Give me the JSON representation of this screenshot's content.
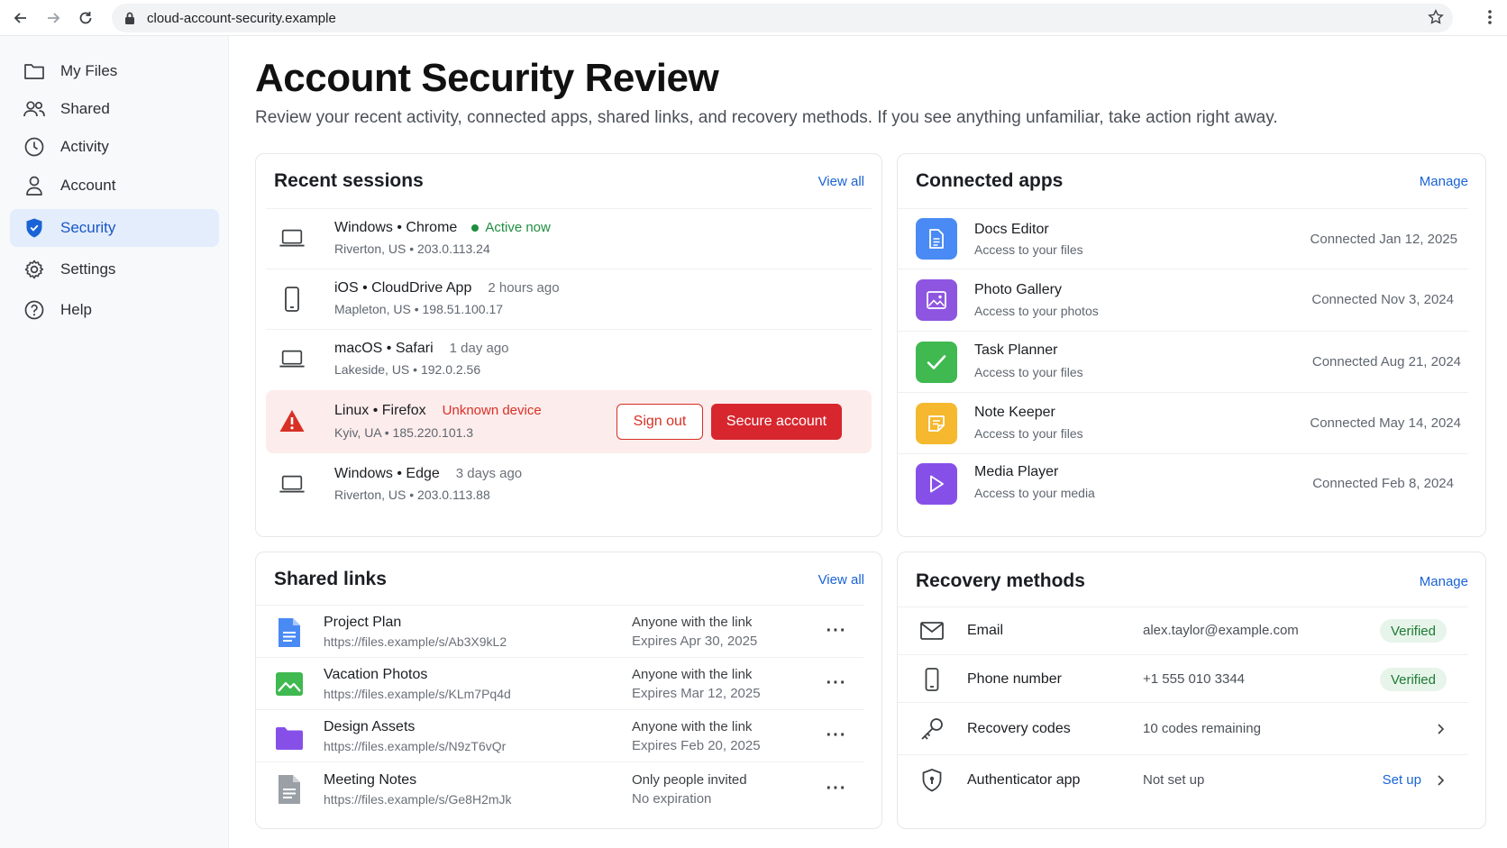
{
  "browser": {
    "url": "cloud-account-security.example"
  },
  "sidebar": {
    "items": [
      {
        "label": "My Files"
      },
      {
        "label": "Shared"
      },
      {
        "label": "Activity"
      },
      {
        "label": "Account"
      },
      {
        "label": "Security"
      },
      {
        "label": "Settings"
      },
      {
        "label": "Help"
      }
    ]
  },
  "page": {
    "title": "Account Security Review",
    "subtitle": "Review your recent activity, connected apps, shared links, and recovery methods. If you see anything unfamiliar, take action right away."
  },
  "sessions": {
    "title": "Recent sessions",
    "view_all": "View all",
    "rows": [
      {
        "device": "Windows • Chrome",
        "status": "Active now",
        "location": "Riverton, US  •  203.0.113.24"
      },
      {
        "device": "iOS • CloudDrive App",
        "status": "2 hours ago",
        "location": "Mapleton, US  •  198.51.100.17"
      },
      {
        "device": "macOS • Safari",
        "status": "1 day ago",
        "location": "Lakeside, US  •  192.0.2.56"
      },
      {
        "device": "Linux • Firefox",
        "status": "Unknown device",
        "location": "Kyiv, UA  •  185.220.101.3"
      },
      {
        "device": "Windows • Edge",
        "status": "3 days ago",
        "location": "Riverton, US  •  203.0.113.88"
      }
    ],
    "sign_out": "Sign out",
    "secure": "Secure account"
  },
  "apps": {
    "title": "Connected apps",
    "manage": "Manage",
    "rows": [
      {
        "name": "Docs Editor",
        "desc": "Access to your files",
        "date": "Connected Jan 12, 2025",
        "color": "#4a8af4"
      },
      {
        "name": "Photo Gallery",
        "desc": "Access to your photos",
        "date": "Connected Nov 3, 2024",
        "color": "#8e55e0"
      },
      {
        "name": "Task Planner",
        "desc": "Access to your files",
        "date": "Connected Aug 21, 2024",
        "color": "#3fb950"
      },
      {
        "name": "Note Keeper",
        "desc": "Access to your files",
        "date": "Connected May 14, 2024",
        "color": "#f5b82e"
      },
      {
        "name": "Media Player",
        "desc": "Access to your media",
        "date": "Connected Feb 8, 2024",
        "color": "#8650e8"
      }
    ]
  },
  "links": {
    "title": "Shared links",
    "view_all": "View all",
    "rows": [
      {
        "name": "Project Plan",
        "url": "https://files.example/s/Ab3X9kL2",
        "access": "Anyone with the link",
        "expires": "Expires Apr 30, 2025"
      },
      {
        "name": "Vacation Photos",
        "url": "https://files.example/s/KLm7Pq4d",
        "access": "Anyone with the link",
        "expires": "Expires Mar 12, 2025"
      },
      {
        "name": "Design Assets",
        "url": "https://files.example/s/N9zT6vQr",
        "access": "Anyone with the link",
        "expires": "Expires Feb 20, 2025"
      },
      {
        "name": "Meeting Notes",
        "url": "https://files.example/s/Ge8H2mJk",
        "access": "Only people invited",
        "expires": "No expiration"
      }
    ]
  },
  "recovery": {
    "title": "Recovery methods",
    "manage": "Manage",
    "rows": [
      {
        "name": "Email",
        "value": "alex.taylor@example.com",
        "badge": "Verified"
      },
      {
        "name": "Phone number",
        "value": "+1 555 010 3344",
        "badge": "Verified"
      },
      {
        "name": "Recovery codes",
        "value": "10 codes remaining"
      },
      {
        "name": "Authenticator app",
        "value": "Not set up",
        "action": "Set up"
      }
    ]
  }
}
